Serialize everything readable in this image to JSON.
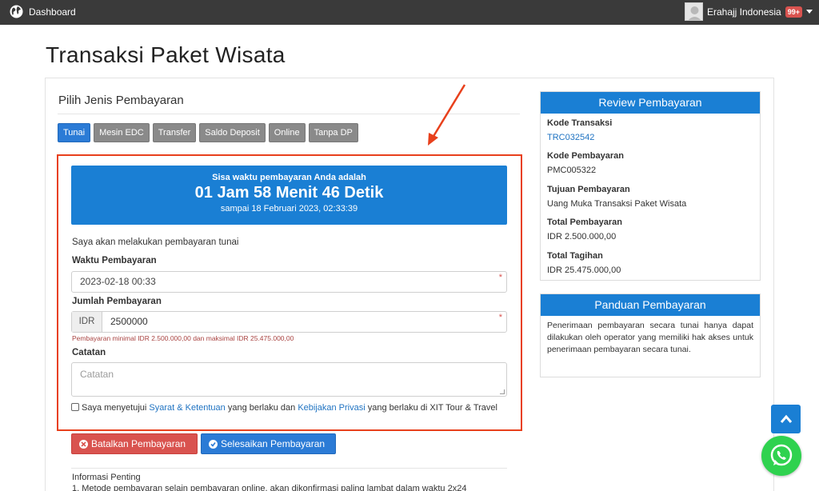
{
  "navbar": {
    "brand": "Dashboard",
    "brand_icon": "globe-icon",
    "user_name": "Erahajj Indonesia",
    "notifications": "99+"
  },
  "page": {
    "title": "Transaksi Paket Wisata"
  },
  "payment": {
    "section_title": "Pilih Jenis Pembayaran",
    "tabs": [
      "Tunai",
      "Mesin EDC",
      "Transfer",
      "Saldo Deposit",
      "Online",
      "Tanpa DP"
    ],
    "active_tab": "Tunai",
    "timer": {
      "caption": "Sisa waktu pembayaran Anda adalah",
      "value": "01 Jam 58 Menit 46 Detik",
      "until": "sampai 18 Februari 2023, 02:33:39"
    },
    "statement": "Saya akan melakukan pembayaran tunai",
    "time_label": "Waktu Pembayaran",
    "time_value": "2023-02-18 00:33",
    "amount_label": "Jumlah Pembayaran",
    "currency": "IDR",
    "amount_value": "2500000",
    "amount_help": "Pembayaran minimal IDR 2.500.000,00 dan maksimal IDR 25.475.000,00",
    "notes_label": "Catatan",
    "notes_placeholder": "Catatan",
    "required_mark": "*",
    "agree": {
      "prefix": "Saya menyetujui ",
      "terms": "Syarat & Ketentuan",
      "middle": " yang berlaku dan ",
      "privacy": "Kebijakan Privasi",
      "suffix": " yang berlaku di XIT Tour & Travel"
    },
    "cancel_button": "Batalkan Pembayaran",
    "finish_button": "Selesaikan Pembayaran",
    "info_title": "Informasi Penting",
    "info_item": "1. Metode pembayaran selain pembayaran online, akan dikonfirmasi paling lambat dalam waktu 2x24"
  },
  "review": {
    "title": "Review Pembayaran",
    "kode_transaksi_label": "Kode Transaksi",
    "kode_transaksi": "TRC032542",
    "kode_pembayaran_label": "Kode Pembayaran",
    "kode_pembayaran": "PMC005322",
    "tujuan_label": "Tujuan Pembayaran",
    "tujuan": "Uang Muka Transaksi Paket Wisata",
    "total_pembayaran_label": "Total Pembayaran",
    "total_pembayaran": "IDR 2.500.000,00",
    "total_tagihan_label": "Total Tagihan",
    "total_tagihan": "IDR 25.475.000,00"
  },
  "guide": {
    "title": "Panduan Pembayaran",
    "text": "Penerimaan pembayaran secara tunai hanya dapat dilakukan oleh operator yang memiliki hak akses untuk penerimaan pembayaran secara tunai."
  },
  "colors": {
    "primary": "#1a7fd4",
    "danger": "#d9534f",
    "annotation": "#e8401c",
    "navbar": "#3a3a3a"
  }
}
